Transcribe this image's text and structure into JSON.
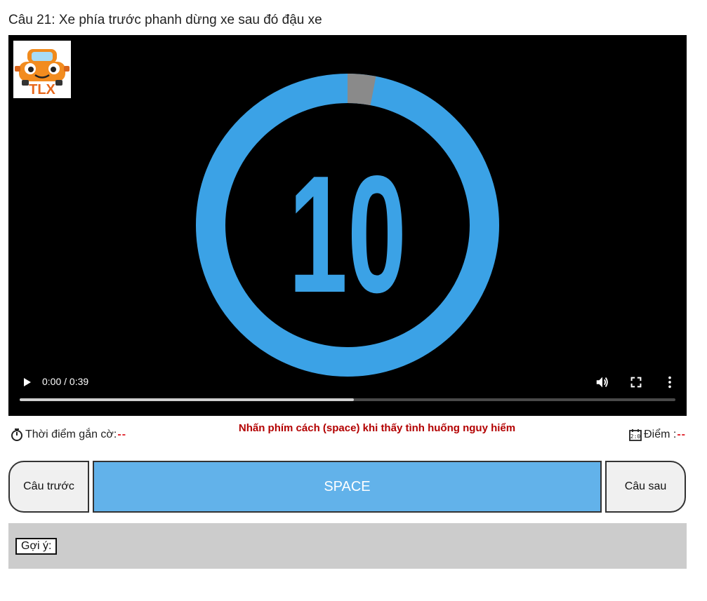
{
  "question": {
    "title": "Câu 21: Xe phía trước phanh dừng xe sau đó đậu xe"
  },
  "video": {
    "logo_text": "TLX",
    "countdown_number": "10",
    "time_readout": "0:00 / 0:39",
    "buffer_fraction": 0.51,
    "countdown_ring_remaining_fraction": 0.97
  },
  "flag": {
    "label": "Thời điểm gắn cờ:",
    "value": "--"
  },
  "instruction": "Nhấn phím cách (space) khi thấy tình huống nguy hiểm",
  "score": {
    "label": "Điểm :",
    "value": "--"
  },
  "nav": {
    "prev_label": "Câu trước",
    "space_label": "SPACE",
    "next_label": "Câu sau"
  },
  "hint": {
    "label": "Gợi ý:"
  },
  "colors": {
    "accent": "#62b2ea",
    "ring": "#3ba2e6",
    "warning": "#b30000",
    "dash": "#e0262e"
  }
}
